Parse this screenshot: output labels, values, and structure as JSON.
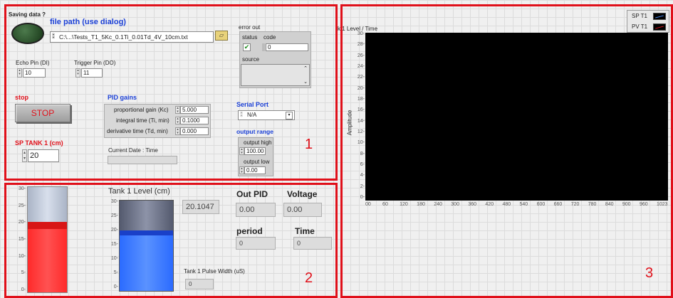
{
  "panel1": {
    "saving_label": "Saving data ?",
    "file_path_label": "file path (use dialog)",
    "file_path_value": "C:\\...\\Tests_T1_5Kc_0.1Ti_0.01Td_4V_10cm.txt",
    "echo_pin_label": "Echo Pin (DI)",
    "echo_pin_value": "10",
    "trigger_pin_label": "Trigger Pin (DO)",
    "trigger_pin_value": "11",
    "stop_label": "stop",
    "stop_button": "STOP",
    "pid_label": "PID gains",
    "pid_rows": [
      {
        "label": "proportional gain (Kc)",
        "value": "5.000"
      },
      {
        "label": "integral time (Ti, min)",
        "value": "0.1000"
      },
      {
        "label": "derivative time (Td, min)",
        "value": "0.000"
      }
    ],
    "sp_label": "SP TANK 1 (cm)",
    "sp_value": "20",
    "date_label": "Current Date : Time",
    "error_out_label": "error out",
    "status_label": "status",
    "code_label": "code",
    "code_value": "0",
    "source_label": "source",
    "serial_label": "Serial Port",
    "serial_value": "N/A",
    "output_range_label": "output range",
    "output_high_label": "output high",
    "output_high_value": "100.00",
    "output_low_label": "output low",
    "output_low_value": "0.00",
    "number": "1"
  },
  "panel2": {
    "left_tank_ticks": [
      "30",
      "25",
      "20",
      "15",
      "10",
      "5",
      "0"
    ],
    "left_tank_level": 20,
    "tank_title": "Tank 1 Level (cm)",
    "tank_ticks": [
      "30",
      "25",
      "20",
      "15",
      "10",
      "5",
      "0"
    ],
    "tank_level": 20.1047,
    "tank_value": "20.1047",
    "pulse_label": "Tank 1 Pulse Width (uS)",
    "pulse_value": "0",
    "out_pid_label": "Out PID",
    "out_pid_value": "0.00",
    "voltage_label": "Voltage",
    "voltage_value": "0.00",
    "period_label": "period",
    "period_value": "0",
    "time_label": "Time",
    "time_value": "0",
    "number": "2"
  },
  "panel3": {
    "chart_title": "k 1 Level / Time",
    "legend": [
      {
        "name": "SP T1",
        "color": "#4a90ff"
      },
      {
        "name": "PV T1",
        "color": "#e0101a"
      }
    ],
    "number": "3"
  },
  "chart_data": {
    "type": "line",
    "title": "k 1 Level / Time",
    "xlabel": "",
    "ylabel": "Amplitude",
    "x_ticks": [
      "00",
      "60",
      "120",
      "180",
      "240",
      "300",
      "360",
      "420",
      "480",
      "540",
      "600",
      "660",
      "720",
      "780",
      "840",
      "900",
      "960",
      "1023"
    ],
    "y_ticks": [
      "30-",
      "28-",
      "26-",
      "24-",
      "22-",
      "20-",
      "18-",
      "16-",
      "14-",
      "12-",
      "10-",
      "8-",
      "6-",
      "4-",
      "2-",
      "0-"
    ],
    "xlim": [
      0,
      1023
    ],
    "ylim": [
      0,
      30
    ],
    "grid": false,
    "legend_position": "top-right",
    "series": [
      {
        "name": "SP T1",
        "values": []
      },
      {
        "name": "PV T1",
        "values": []
      }
    ]
  }
}
